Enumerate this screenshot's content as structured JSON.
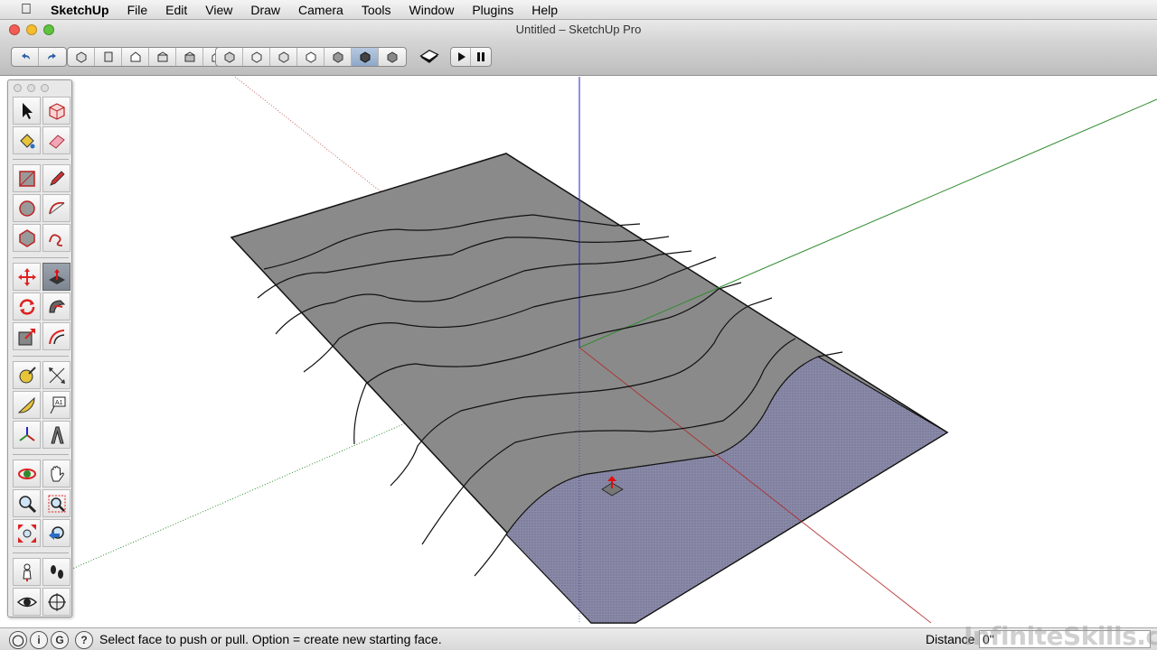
{
  "menubar": {
    "app_name": "SketchUp",
    "items": [
      "File",
      "Edit",
      "View",
      "Draw",
      "Camera",
      "Tools",
      "Window",
      "Plugins",
      "Help"
    ]
  },
  "window": {
    "title": "Untitled – SketchUp Pro"
  },
  "toolbar": {
    "groups": [
      [
        "undo-icon",
        "redo-icon"
      ],
      [
        "iso-view-icon",
        "top-view-icon",
        "front-view-icon",
        "right-view-icon",
        "back-view-icon",
        "left-view-icon"
      ],
      [
        "xray-icon",
        "wireframe-icon",
        "hidden-line-icon",
        "shaded-icon",
        "shaded-textures-icon",
        "monochrome-icon",
        "shadows-icon"
      ],
      [
        "model-info-icon"
      ],
      [
        "play-icon",
        "pause-icon"
      ]
    ],
    "active_style": "monochrome-icon"
  },
  "palette": {
    "tools": [
      [
        "select-icon",
        "make-component-icon"
      ],
      [
        "paint-bucket-icon",
        "eraser-icon"
      ],
      [
        "rectangle-icon",
        "pencil-icon"
      ],
      [
        "circle-icon",
        "arc-icon"
      ],
      [
        "polygon-icon",
        "freehand-icon"
      ],
      [
        "move-icon",
        "push-pull-icon"
      ],
      [
        "rotate-icon",
        "follow-me-icon"
      ],
      [
        "scale-icon",
        "offset-icon"
      ],
      [
        "tape-measure-icon",
        "dimension-icon"
      ],
      [
        "protractor-icon",
        "text-icon"
      ],
      [
        "axes-icon",
        "3d-text-icon"
      ],
      [
        "orbit-icon",
        "pan-icon"
      ],
      [
        "zoom-icon",
        "zoom-window-icon"
      ],
      [
        "zoom-extents-icon",
        "previous-view-icon"
      ],
      [
        "position-camera-icon",
        "walk-icon"
      ],
      [
        "look-around-icon",
        "section-plane-icon"
      ]
    ],
    "active_tool": "push-pull-icon"
  },
  "status": {
    "message": "Select face to push or pull.  Option = create new starting face.",
    "distance_label": "Distance",
    "distance_value": "0\"",
    "watermark": "InfiniteSkills.com"
  },
  "colors": {
    "red_axis": "#b22222",
    "green_axis": "#2e8b2e",
    "blue_axis": "#2222cc",
    "face": "#8a8a8a",
    "selected_face": "#8585a8"
  }
}
